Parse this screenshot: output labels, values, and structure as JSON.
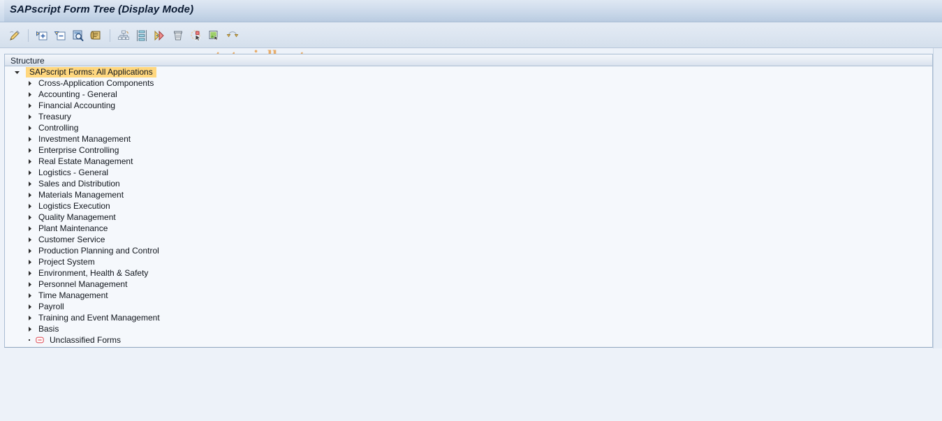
{
  "window": {
    "title": "SAPscript Form Tree (Display Mode)"
  },
  "watermark": {
    "text": "www.tutorialkart.com",
    "color": "#e8a860"
  },
  "colors": {
    "titlebar_top": "#dfe8f3",
    "titlebar_bottom": "#b9cbe0",
    "toolbar_bg": "#dde6f1",
    "tree_bg": "#F5F8FC",
    "selection_highlight": "#FFD77E",
    "page_bg": "#EDF2F9",
    "border": "#a9bcd2"
  },
  "toolbar": {
    "buttons": [
      {
        "icon": "pencil-edit-icon",
        "label": "Change"
      },
      {
        "sep": true
      },
      {
        "icon": "expand-node-icon",
        "label": "Expand Node"
      },
      {
        "icon": "collapse-node-icon",
        "label": "Collapse Node"
      },
      {
        "icon": "find-icon",
        "label": "Find"
      },
      {
        "icon": "scroll-document-icon",
        "label": "Display Form"
      },
      {
        "sep": true
      },
      {
        "icon": "hierarchy-icon",
        "label": "Structure"
      },
      {
        "icon": "align-nodes-icon",
        "label": "Align"
      },
      {
        "icon": "execute-next-icon",
        "label": "Execute"
      },
      {
        "icon": "trash-delete-icon",
        "label": "Delete"
      },
      {
        "icon": "copy-select-icon",
        "label": "Copy"
      },
      {
        "icon": "picture-table-icon",
        "label": "Graphic"
      },
      {
        "icon": "refresh-icon",
        "label": "Refresh"
      }
    ]
  },
  "structure_header": {
    "label": "Structure"
  },
  "tree": {
    "root": {
      "label": "SAPscript Forms: All Applications",
      "expanded": true,
      "selected": true,
      "icon": "triangle-down-icon"
    },
    "items": [
      {
        "label": "Cross-Application Components",
        "icon": "triangle-right-icon",
        "expanded": false
      },
      {
        "label": "Accounting - General",
        "icon": "triangle-right-icon",
        "expanded": false
      },
      {
        "label": "Financial Accounting",
        "icon": "triangle-right-icon",
        "expanded": false
      },
      {
        "label": "Treasury",
        "icon": "triangle-right-icon",
        "expanded": false
      },
      {
        "label": "Controlling",
        "icon": "triangle-right-icon",
        "expanded": false
      },
      {
        "label": "Investment Management",
        "icon": "triangle-right-icon",
        "expanded": false
      },
      {
        "label": "Enterprise Controlling",
        "icon": "triangle-right-icon",
        "expanded": false
      },
      {
        "label": "Real Estate Management",
        "icon": "triangle-right-icon",
        "expanded": false
      },
      {
        "label": "Logistics - General",
        "icon": "triangle-right-icon",
        "expanded": false
      },
      {
        "label": "Sales and Distribution",
        "icon": "triangle-right-icon",
        "expanded": false
      },
      {
        "label": "Materials Management",
        "icon": "triangle-right-icon",
        "expanded": false
      },
      {
        "label": "Logistics Execution",
        "icon": "triangle-right-icon",
        "expanded": false
      },
      {
        "label": "Quality Management",
        "icon": "triangle-right-icon",
        "expanded": false
      },
      {
        "label": "Plant Maintenance",
        "icon": "triangle-right-icon",
        "expanded": false
      },
      {
        "label": "Customer Service",
        "icon": "triangle-right-icon",
        "expanded": false
      },
      {
        "label": "Production Planning and Control",
        "icon": "triangle-right-icon",
        "expanded": false
      },
      {
        "label": "Project System",
        "icon": "triangle-right-icon",
        "expanded": false
      },
      {
        "label": "Environment, Health & Safety",
        "icon": "triangle-right-icon",
        "expanded": false
      },
      {
        "label": "Personnel Management",
        "icon": "triangle-right-icon",
        "expanded": false
      },
      {
        "label": "Time Management",
        "icon": "triangle-right-icon",
        "expanded": false
      },
      {
        "label": "Payroll",
        "icon": "triangle-right-icon",
        "expanded": false
      },
      {
        "label": "Training and Event Management",
        "icon": "triangle-right-icon",
        "expanded": false
      },
      {
        "label": "Basis",
        "icon": "triangle-right-icon",
        "expanded": false
      },
      {
        "label": "Unclassified Forms",
        "icon": "minus-box-icon",
        "leaf": true,
        "expanded": false
      }
    ]
  }
}
